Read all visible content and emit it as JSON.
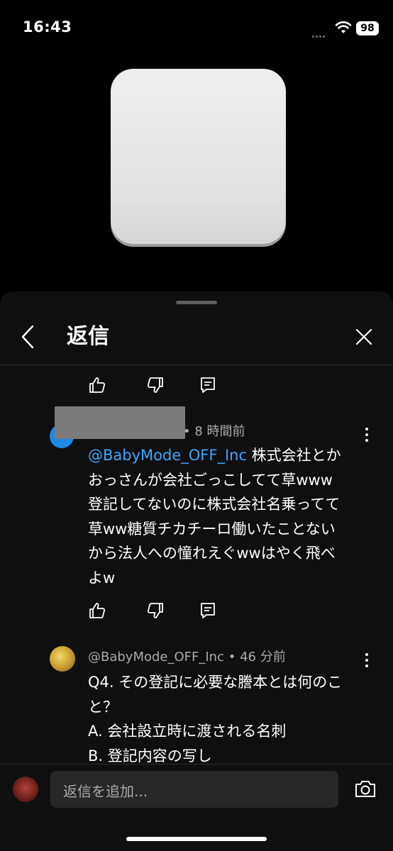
{
  "status_bar": {
    "time": "16:43",
    "battery": "98"
  },
  "header": {
    "title": "返信"
  },
  "comment1": {
    "timestamp": "• 8 時間前",
    "mention": "@BabyMode_OFF_Inc",
    "lines": [
      " 株式会社とか",
      "おっさんが会社ごっこしてて草www",
      "登記してないのに株式会社名乗ってて",
      "草ww糖質チカチーロ働いたことない",
      "から法人への憧れえぐwwはやく飛べ",
      "よw"
    ]
  },
  "comment2": {
    "author": "@BabyMode_OFF_Inc",
    "timestamp": "• 46 分前",
    "lines": [
      "Q4. その登記に必要な謄本とは何のこ",
      "と？",
      "A. 会社設立時に渡される名刺",
      "B. 登記内容の写し"
    ]
  },
  "reply_input": {
    "placeholder": "返信を追加..."
  },
  "icons": {
    "like": "thumbs-up-icon",
    "dislike": "thumbs-down-icon",
    "reply": "reply-comment-icon",
    "more": "more-vert-icon",
    "camera": "camera-icon",
    "back": "chevron-left-icon",
    "close": "close-icon"
  },
  "colors": {
    "accent_mention": "#3ea6ff",
    "background": "#0f0f0f"
  }
}
